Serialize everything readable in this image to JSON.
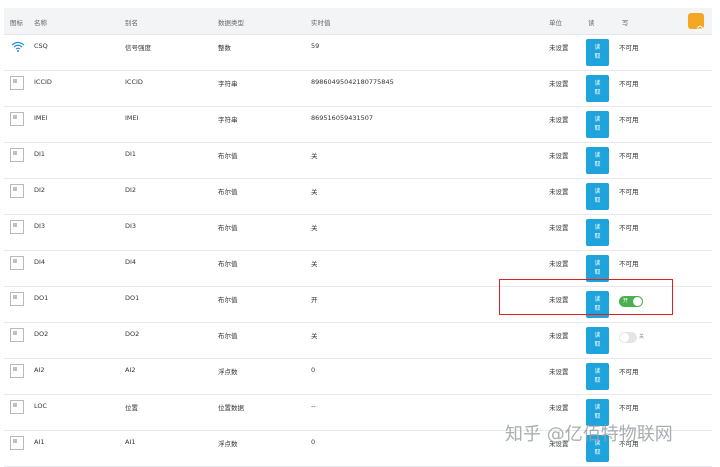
{
  "header": {
    "flag": "图标",
    "name": "名称",
    "alias": "别名",
    "type": "数据类型",
    "value": "实时值",
    "unit": "单位",
    "read": "读",
    "write": "写"
  },
  "read_label": "读\n取",
  "rows": [
    {
      "icon": "wifi",
      "name": "CSQ",
      "alias": "信号强度",
      "type": "整数",
      "value": "59",
      "unit": "未设置",
      "write": "不可用"
    },
    {
      "icon": "image",
      "name": "ICCID",
      "alias": "ICCID",
      "type": "字符串",
      "value": "89860495042180775845",
      "unit": "未设置",
      "write": "不可用"
    },
    {
      "icon": "image",
      "name": "IMEI",
      "alias": "IMEI",
      "type": "字符串",
      "value": "869516059431507",
      "unit": "未设置",
      "write": "不可用"
    },
    {
      "icon": "image",
      "name": "DI1",
      "alias": "DI1",
      "type": "布尔值",
      "value": "关",
      "unit": "未设置",
      "write": "不可用"
    },
    {
      "icon": "image",
      "name": "DI2",
      "alias": "DI2",
      "type": "布尔值",
      "value": "关",
      "unit": "未设置",
      "write": "不可用"
    },
    {
      "icon": "image",
      "name": "DI3",
      "alias": "DI3",
      "type": "布尔值",
      "value": "关",
      "unit": "未设置",
      "write": "不可用"
    },
    {
      "icon": "image",
      "name": "DI4",
      "alias": "DI4",
      "type": "布尔值",
      "value": "关",
      "unit": "未设置",
      "write": "不可用"
    },
    {
      "icon": "image",
      "name": "DO1",
      "alias": "DO1",
      "type": "布尔值",
      "value": "开",
      "unit": "未设置",
      "write_toggle": "on",
      "toggle_label": "开"
    },
    {
      "icon": "image",
      "name": "DO2",
      "alias": "DO2",
      "type": "布尔值",
      "value": "关",
      "unit": "未设置",
      "write_toggle": "off",
      "toggle_label": "关"
    },
    {
      "icon": "image",
      "name": "AI2",
      "alias": "AI2",
      "type": "浮点数",
      "value": "0",
      "unit": "未设置",
      "write": "不可用"
    },
    {
      "icon": "image",
      "name": "LOC",
      "alias": "位置",
      "type": "位置数据",
      "value": "--",
      "unit": "未设置",
      "write": "不可用"
    },
    {
      "icon": "image",
      "name": "AI1",
      "alias": "AI1",
      "type": "浮点数",
      "value": "0",
      "unit": "未设置",
      "write": "不可用"
    }
  ],
  "watermark": "知乎 @亿佰特物联网",
  "colors": {
    "read_button": "#1fa3dc",
    "toggle_on": "#4caf50",
    "highlight": "#e02020",
    "settings_button": "#f5a623"
  }
}
